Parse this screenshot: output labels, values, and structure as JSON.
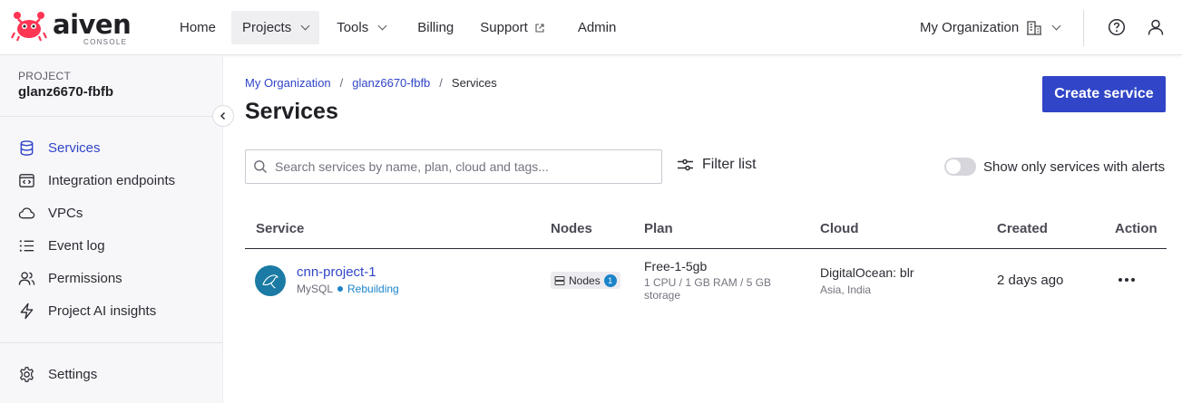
{
  "brand": {
    "name": "aiven",
    "sub": "CONSOLE"
  },
  "nav": {
    "items": [
      {
        "label": "Home"
      },
      {
        "label": "Projects"
      },
      {
        "label": "Tools"
      },
      {
        "label": "Billing"
      },
      {
        "label": "Support"
      },
      {
        "label": "Admin"
      }
    ],
    "org_label": "My Organization"
  },
  "sidebar": {
    "project_caption": "PROJECT",
    "project_name": "glanz6670-fbfb",
    "items": [
      {
        "label": "Services",
        "icon": "database-icon"
      },
      {
        "label": "Integration endpoints",
        "icon": "code-window-icon"
      },
      {
        "label": "VPCs",
        "icon": "cloud-icon"
      },
      {
        "label": "Event log",
        "icon": "list-icon"
      },
      {
        "label": "Permissions",
        "icon": "users-icon"
      },
      {
        "label": "Project AI insights",
        "icon": "lightning-icon"
      }
    ],
    "settings_label": "Settings"
  },
  "breadcrumb": {
    "org": "My Organization",
    "project": "glanz6670-fbfb",
    "current": "Services"
  },
  "page": {
    "title": "Services",
    "create_button": "Create service"
  },
  "search": {
    "placeholder": "Search services by name, plan, cloud and tags..."
  },
  "filter": {
    "label": "Filter list"
  },
  "alerts_toggle": {
    "label": "Show only services with alerts"
  },
  "table": {
    "headers": [
      "Service",
      "Nodes",
      "Plan",
      "Cloud",
      "Created",
      "Action"
    ],
    "rows": [
      {
        "name": "cnn-project-1",
        "type": "MySQL",
        "status": "Rebuilding",
        "nodes_label": "Nodes",
        "nodes_count": "1",
        "plan": "Free-1-5gb",
        "plan_spec": "1 CPU / 1 GB RAM / 5 GB storage",
        "cloud": "DigitalOcean: blr",
        "region": "Asia, India",
        "created": "2 days ago"
      }
    ]
  },
  "colors": {
    "accent": "#3045c7",
    "status": "#1b84c9",
    "mysql": "#1b7ba4",
    "brand": "#ff3554"
  }
}
